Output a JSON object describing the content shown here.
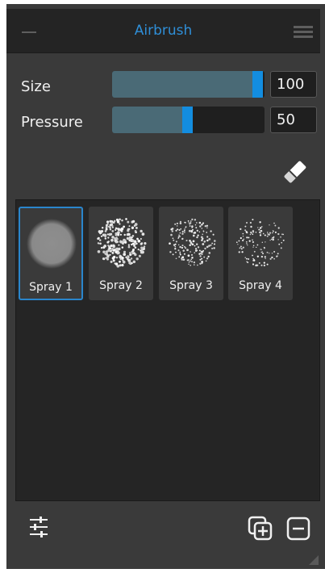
{
  "panel": {
    "title": "Airbrush"
  },
  "icons": {
    "minimize": "minimize-icon",
    "menu": "hamburger-menu-icon",
    "eraser": "eraser-icon",
    "settings": "sliders-settings-icon",
    "add_preset": "duplicate-add-icon",
    "remove_preset": "remove-icon",
    "resize": "resize-grip-icon"
  },
  "colors": {
    "accent": "#1e8fe0",
    "title": "#2f8fd8",
    "panel_background": "#3a3a3a",
    "dark_background": "#242424",
    "slider_fill": "#4a6a76"
  },
  "sliders": {
    "size": {
      "label": "Size",
      "value": "100",
      "level": 1.0
    },
    "pressure": {
      "label": "Pressure",
      "value": "50",
      "level": 0.5
    }
  },
  "presets": [
    {
      "label": "Spray 1",
      "selected": true
    },
    {
      "label": "Spray 2",
      "selected": false
    },
    {
      "label": "Spray 3",
      "selected": false
    },
    {
      "label": "Spray 4",
      "selected": false
    }
  ]
}
